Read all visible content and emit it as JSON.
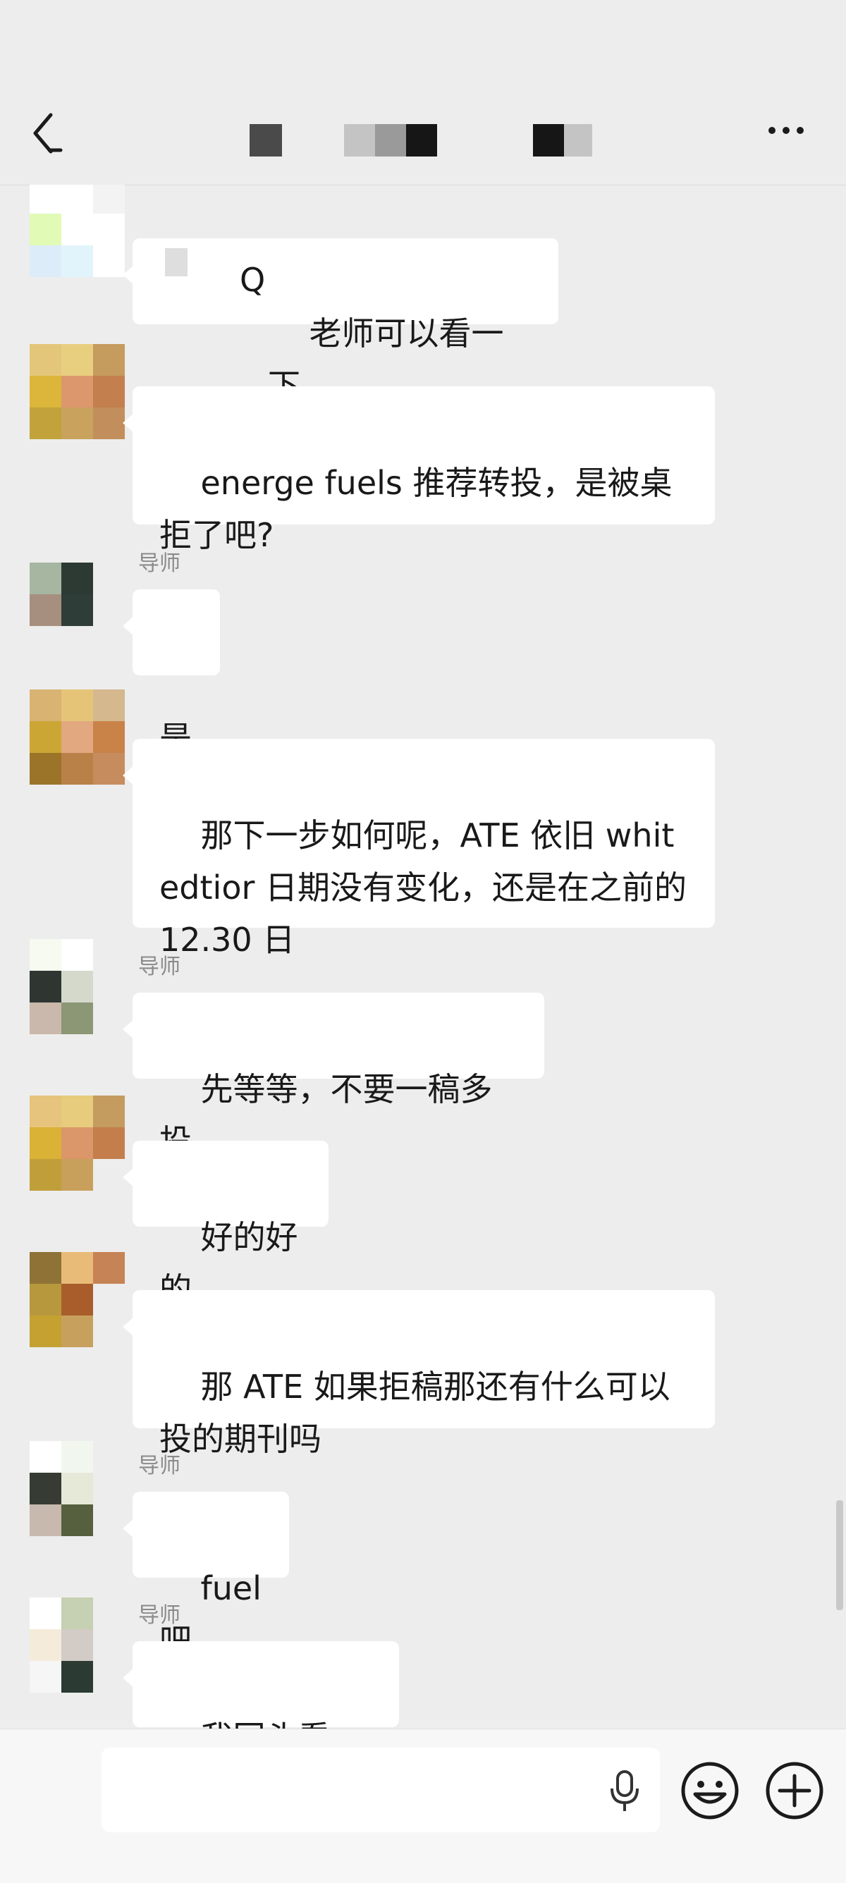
{
  "header": {
    "title_redacted": true
  },
  "messages": [
    {
      "sender": "",
      "text": "老师可以看一下",
      "redacted_prefix": "Q",
      "lines": 1
    },
    {
      "sender": "",
      "text": "energe fuels 推荐转投，是被桌拒了吧?",
      "lines": 2
    },
    {
      "sender": "导师",
      "text": "是",
      "lines": 1
    },
    {
      "sender": "",
      "text": "那下一步如何呢，ATE 依旧 whitedtior 日期没有变化，还是在之前的 12.30 日",
      "lines": 3
    },
    {
      "sender": "导师",
      "text": "先等等，不要一稿多投",
      "lines": 1
    },
    {
      "sender": "",
      "text": "好的好的",
      "lines": 1
    },
    {
      "sender": "",
      "text": "那 ATE 如果拒稿那还有什么可以投的期刊吗",
      "lines": 2
    },
    {
      "sender": "导师",
      "text": "fuel 吧",
      "lines": 1
    },
    {
      "sender": "导师",
      "text": "我回头看一下",
      "lines": 1
    }
  ],
  "input_bar": {
    "text_value": "",
    "icons": [
      "microphone-icon",
      "emoji-icon",
      "plus-icon"
    ]
  },
  "colors": {
    "background": "#ededed",
    "bubble": "#ffffff",
    "text": "#191919",
    "sender_label": "#8a8a8a"
  }
}
